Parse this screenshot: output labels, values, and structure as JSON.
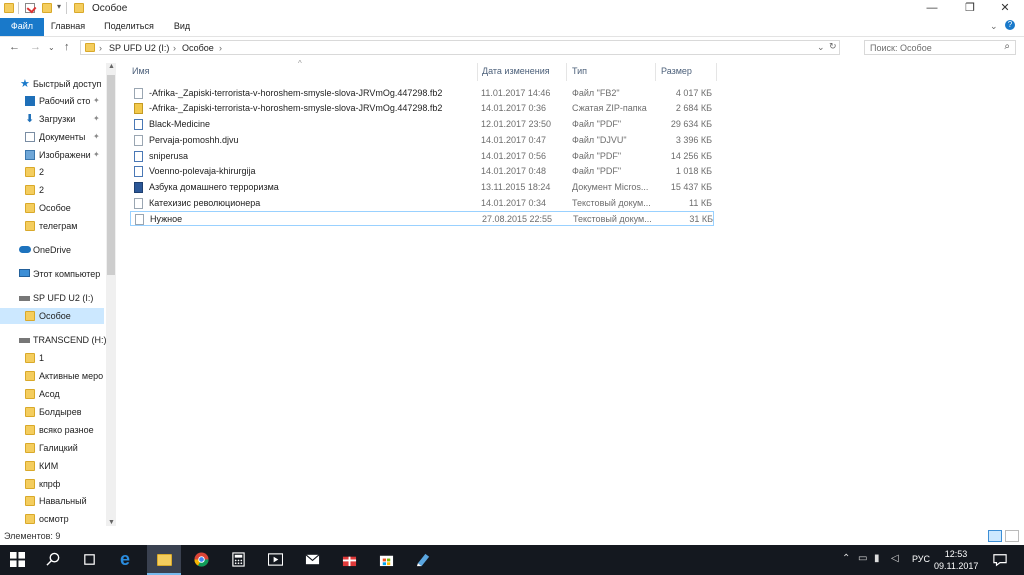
{
  "window": {
    "title": "Особое",
    "minimize": "—",
    "maximize": "❐",
    "close": "✕"
  },
  "ribbon": {
    "tabs": [
      "Файл",
      "Главная",
      "Поделиться",
      "Вид"
    ]
  },
  "address": {
    "crumbs": [
      "SP UFD U2 (I:)",
      "Особое"
    ],
    "search_placeholder": "Поиск: Особое"
  },
  "sidebar": {
    "items": [
      {
        "label": "Быстрый доступ",
        "icon": "star-icon"
      },
      {
        "label": "Рабочий сто",
        "icon": "desktop-icon"
      },
      {
        "label": "Загрузки",
        "icon": "download-icon"
      },
      {
        "label": "Документы",
        "icon": "documents-icon"
      },
      {
        "label": "Изображени",
        "icon": "pictures-icon"
      },
      {
        "label": "2",
        "icon": "folder-icon"
      },
      {
        "label": "2",
        "icon": "folder-icon"
      },
      {
        "label": "Особое",
        "icon": "folder-icon"
      },
      {
        "label": "телеграм",
        "icon": "folder-icon"
      },
      {
        "label": "OneDrive",
        "icon": "onedrive-icon"
      },
      {
        "label": "Этот компьютер",
        "icon": "computer-icon"
      },
      {
        "label": "SP UFD U2 (I:)",
        "icon": "drive-icon"
      },
      {
        "label": "Особое",
        "icon": "folder-icon"
      },
      {
        "label": "TRANSCEND (H:)",
        "icon": "drive-icon"
      },
      {
        "label": "1",
        "icon": "folder-icon"
      },
      {
        "label": "Активные меро",
        "icon": "folder-icon"
      },
      {
        "label": "Асод",
        "icon": "folder-icon"
      },
      {
        "label": "Болдырев",
        "icon": "folder-icon"
      },
      {
        "label": "всяко разное",
        "icon": "folder-icon"
      },
      {
        "label": "Галицкий",
        "icon": "folder-icon"
      },
      {
        "label": "КИМ",
        "icon": "folder-icon"
      },
      {
        "label": "кпрф",
        "icon": "folder-icon"
      },
      {
        "label": "Навальный",
        "icon": "folder-icon"
      },
      {
        "label": "осмотр",
        "icon": "folder-icon"
      }
    ]
  },
  "columns": {
    "name": "Имя",
    "date": "Дата изменения",
    "type": "Тип",
    "size": "Размер"
  },
  "files": [
    {
      "name": "-Afrika-_Zapiski-terrorista-v-horoshem-smysle-slova-JRVmOg.447298.fb2",
      "date": "11.01.2017 14:46",
      "type": "Файл \"FB2\"",
      "size": "4 017 КБ",
      "icon": "file-icon"
    },
    {
      "name": "-Afrika-_Zapiski-terrorista-v-horoshem-smysle-slova-JRVmOg.447298.fb2",
      "date": "14.01.2017 0:36",
      "type": "Сжатая ZIP-папка",
      "size": "2 684 КБ",
      "icon": "zip-icon"
    },
    {
      "name": "Black-Medicine",
      "date": "12.01.2017 23:50",
      "type": "Файл \"PDF\"",
      "size": "29 634 КБ",
      "icon": "pdf-icon"
    },
    {
      "name": "Pervaja-pomoshh.djvu",
      "date": "14.01.2017 0:47",
      "type": "Файл \"DJVU\"",
      "size": "3 396 КБ",
      "icon": "file-icon"
    },
    {
      "name": "sniperusa",
      "date": "14.01.2017 0:56",
      "type": "Файл \"PDF\"",
      "size": "14 256 КБ",
      "icon": "pdf-icon"
    },
    {
      "name": "Voenno-polevaja-khirurgija",
      "date": "14.01.2017 0:48",
      "type": "Файл \"PDF\"",
      "size": "1 018 КБ",
      "icon": "pdf-icon"
    },
    {
      "name": "Азбука домашнего терроризма",
      "date": "13.11.2015 18:24",
      "type": "Документ Micros...",
      "size": "15 437 КБ",
      "icon": "word-icon"
    },
    {
      "name": "Катехизис революционера",
      "date": "14.01.2017 0:34",
      "type": "Текстовый докум...",
      "size": "11 КБ",
      "icon": "text-file-icon"
    },
    {
      "name": "Нужное",
      "date": "27.08.2015 22:55",
      "type": "Текстовый докум...",
      "size": "31 КБ",
      "icon": "text-file-icon"
    }
  ],
  "status": {
    "items_count": "Элементов: 9"
  },
  "taskbar": {
    "lang": "РУС",
    "time": "12:53",
    "date": "09.11.2017"
  },
  "colors": {
    "accent": "#1979ca",
    "selection": "#cce8ff",
    "taskbar": "#14181f",
    "folder": "#f4cd5e"
  }
}
